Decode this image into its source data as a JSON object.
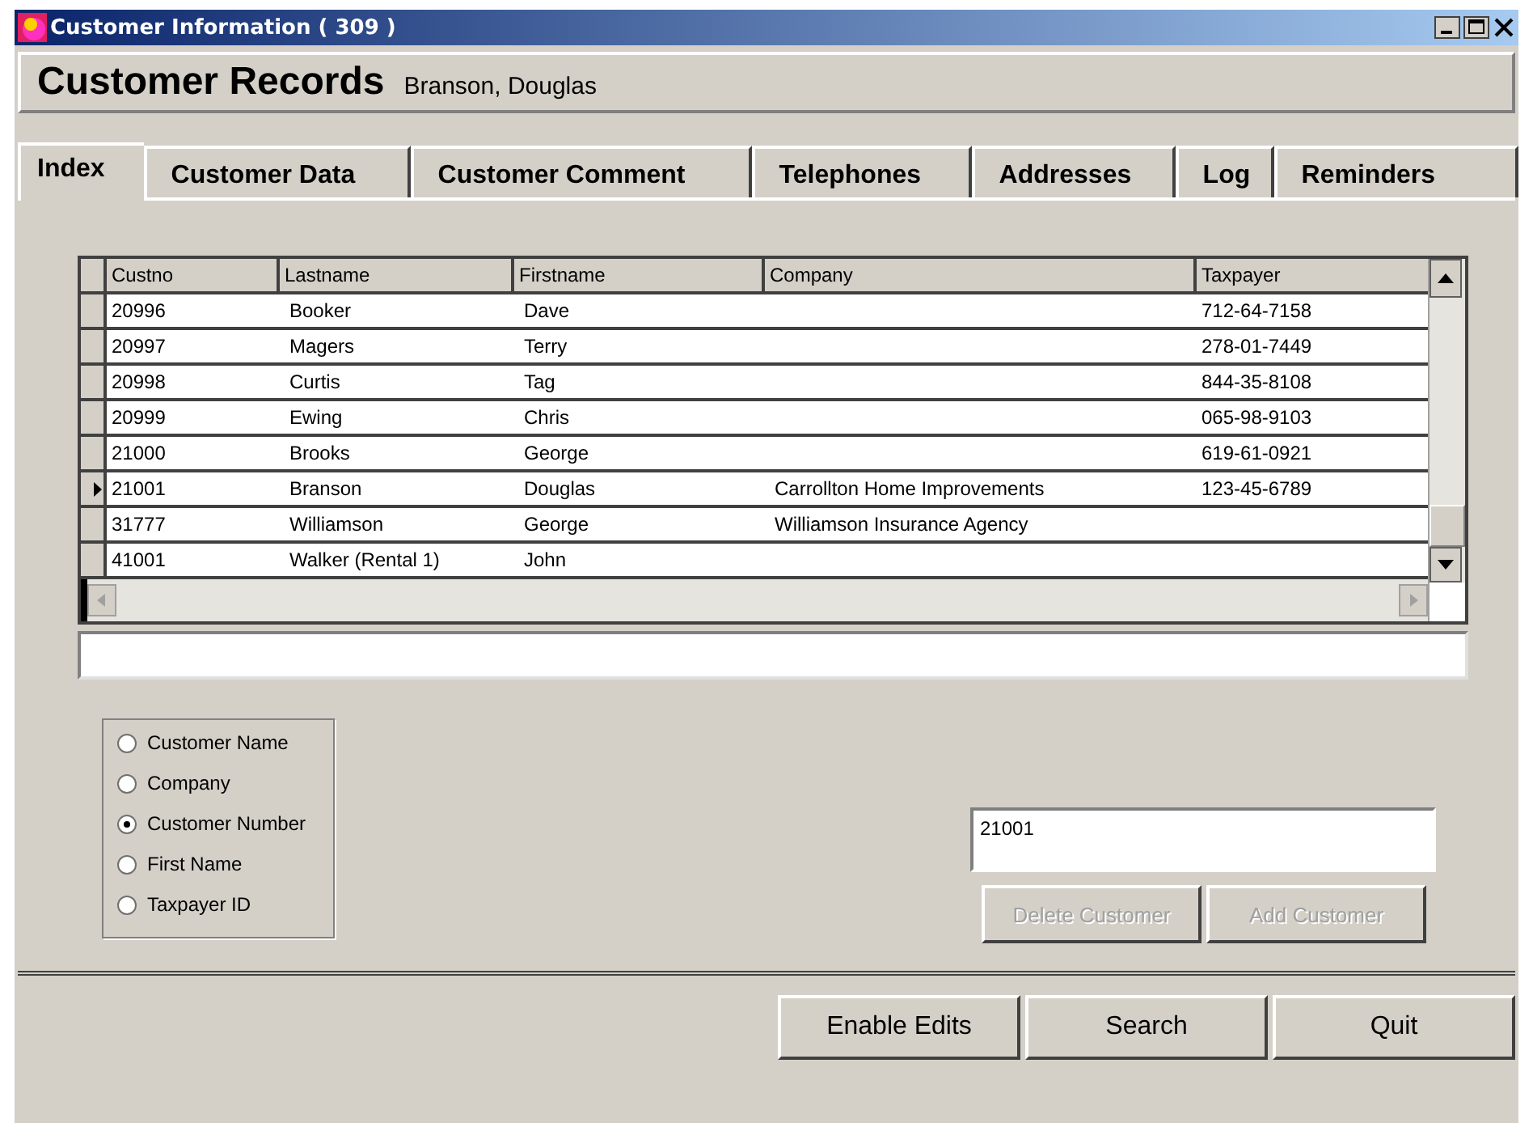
{
  "window": {
    "title": "Customer Information ( 309 )"
  },
  "header": {
    "title": "Customer Records",
    "customer": "Branson,  Douglas"
  },
  "tabs": [
    {
      "label": "Index",
      "selected": true
    },
    {
      "label": "Customer Data",
      "selected": false
    },
    {
      "label": "Customer Comment",
      "selected": false
    },
    {
      "label": "Telephones",
      "selected": false
    },
    {
      "label": "Addresses",
      "selected": false
    },
    {
      "label": "Log",
      "selected": false
    },
    {
      "label": "Reminders",
      "selected": false
    }
  ],
  "table": {
    "columns": [
      "Custno",
      "Lastname",
      "Firstname",
      "Company",
      "Taxpayer"
    ],
    "rows": [
      {
        "cells": [
          "20996",
          "Booker",
          "Dave",
          "",
          "712-64-7158"
        ],
        "selected": false
      },
      {
        "cells": [
          "20997",
          "Magers",
          "Terry",
          "",
          "278-01-7449"
        ],
        "selected": false
      },
      {
        "cells": [
          "20998",
          "Curtis",
          "Tag",
          "",
          "844-35-8108"
        ],
        "selected": false
      },
      {
        "cells": [
          "20999",
          "Ewing",
          "Chris",
          "",
          "065-98-9103"
        ],
        "selected": false
      },
      {
        "cells": [
          "21000",
          "Brooks",
          "George",
          "",
          "619-61-0921"
        ],
        "selected": false
      },
      {
        "cells": [
          "21001",
          "Branson",
          "Douglas",
          "Carrollton Home Improvements",
          "123-45-6789"
        ],
        "selected": true
      },
      {
        "cells": [
          "31777",
          "Williamson",
          "George",
          "Williamson Insurance Agency",
          ""
        ],
        "selected": false
      },
      {
        "cells": [
          "41001",
          "Walker  (Rental 1)",
          "John",
          "",
          ""
        ],
        "selected": false
      }
    ]
  },
  "search_by": [
    {
      "label": "Customer Name",
      "selected": false
    },
    {
      "label": "Company",
      "selected": false
    },
    {
      "label": "Customer Number",
      "selected": true
    },
    {
      "label": "First Name",
      "selected": false
    },
    {
      "label": "Taxpayer ID",
      "selected": false
    }
  ],
  "search_field": {
    "value": "21001"
  },
  "record_buttons": [
    {
      "label": "Delete Customer",
      "disabled": true
    },
    {
      "label": "Add Customer",
      "disabled": true
    }
  ],
  "footer_buttons": [
    {
      "label": "Enable Edits",
      "disabled": false
    },
    {
      "label": "Search",
      "disabled": false
    },
    {
      "label": "Quit",
      "disabled": false
    }
  ]
}
